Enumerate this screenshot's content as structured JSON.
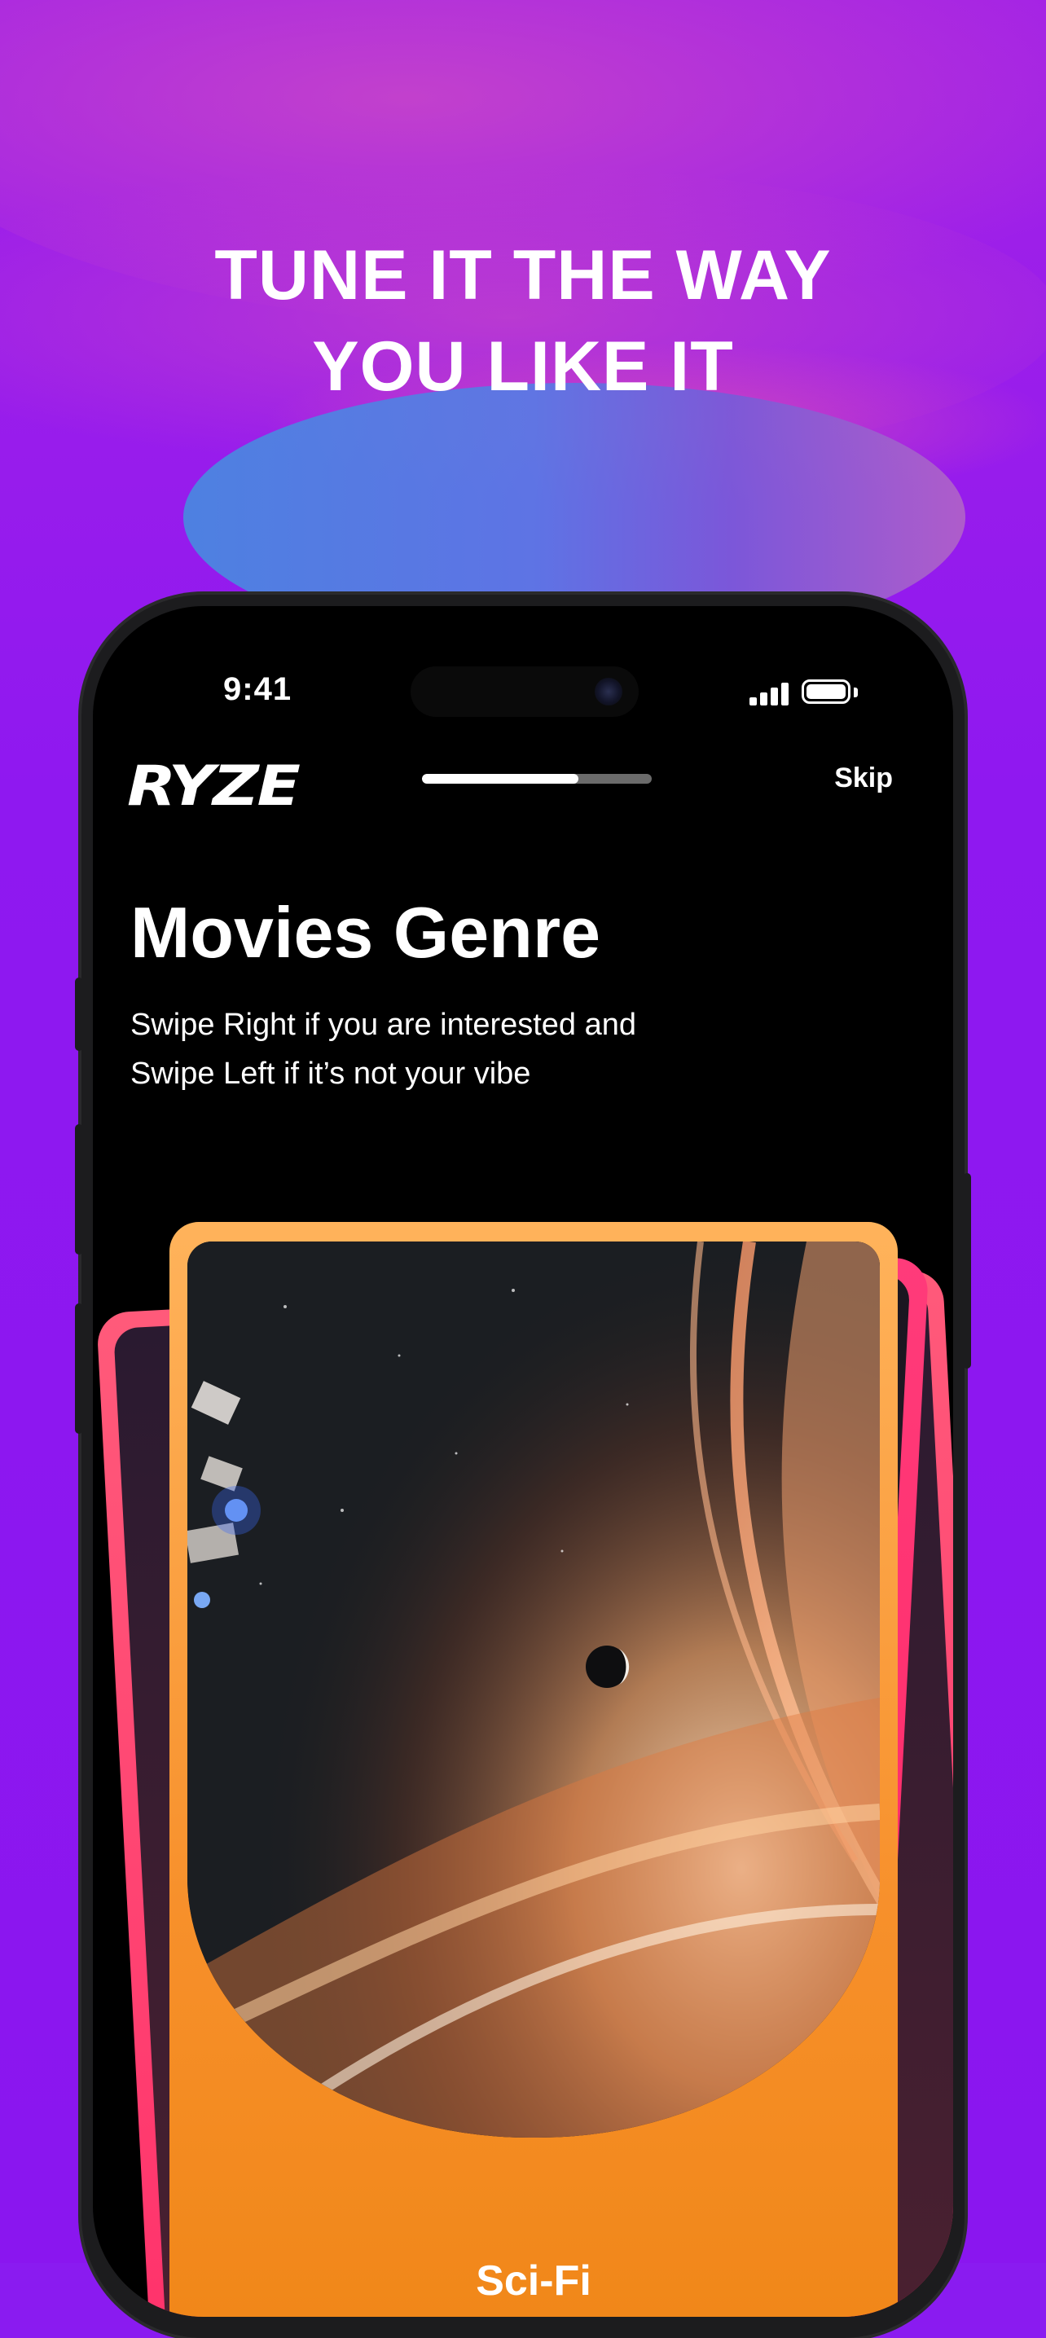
{
  "promo": {
    "headline_line1": "TUNE IT THE WAY",
    "headline_line2": "YOU LIKE IT"
  },
  "status_bar": {
    "time": "9:41"
  },
  "header": {
    "logo": "RYZE",
    "skip_label": "Skip",
    "progress": 0.68
  },
  "page": {
    "title": "Movies Genre",
    "subtitle_line1": "Swipe Right if you are interested and",
    "subtitle_line2": "Swipe Left if it’s not your vibe"
  },
  "card": {
    "genre": "Sci-Fi"
  },
  "colors": {
    "background": "#8a16ef",
    "card_front": "#f7902b",
    "card_back": "#ff2e6a"
  }
}
